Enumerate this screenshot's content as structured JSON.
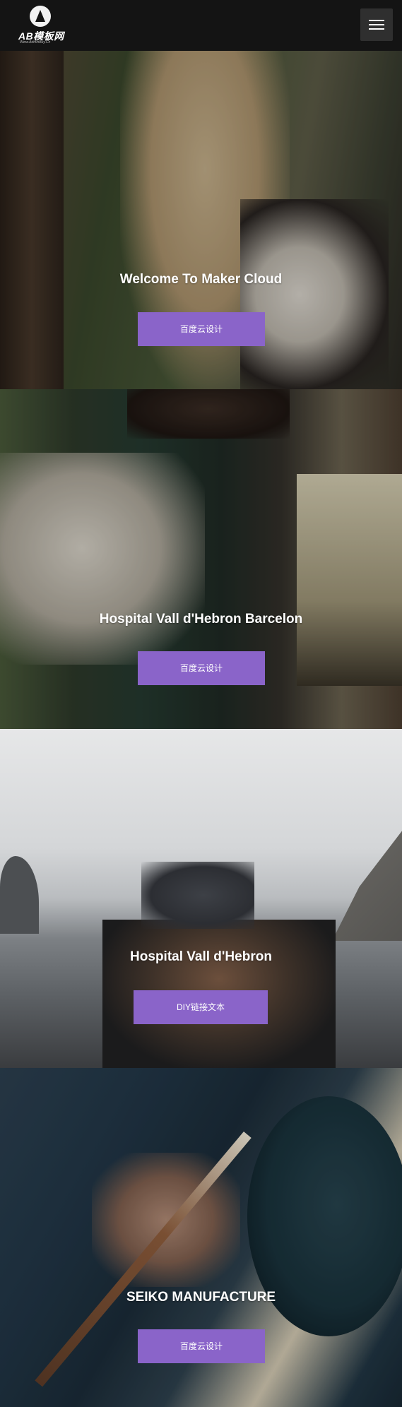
{
  "header": {
    "logo_text": "AB模板网",
    "logo_subtext": "Www.AdminBuy.Cn",
    "menu_icon": "hamburger-menu-icon"
  },
  "slides": [
    {
      "title": "Welcome To Maker Cloud",
      "button_label": "百度云设计"
    },
    {
      "title": "Hospital Vall d'Hebron Barcelon",
      "button_label": "百度云设计"
    },
    {
      "title": "Hospital Vall d'Hebron",
      "button_label": "DIY链接文本"
    },
    {
      "title": "SEIKO MANUFACTURE",
      "button_label": "百度云设计"
    }
  ],
  "colors": {
    "topbar": "#141414",
    "button": "#8a64c9",
    "menu_button": "#2f2f2f"
  }
}
